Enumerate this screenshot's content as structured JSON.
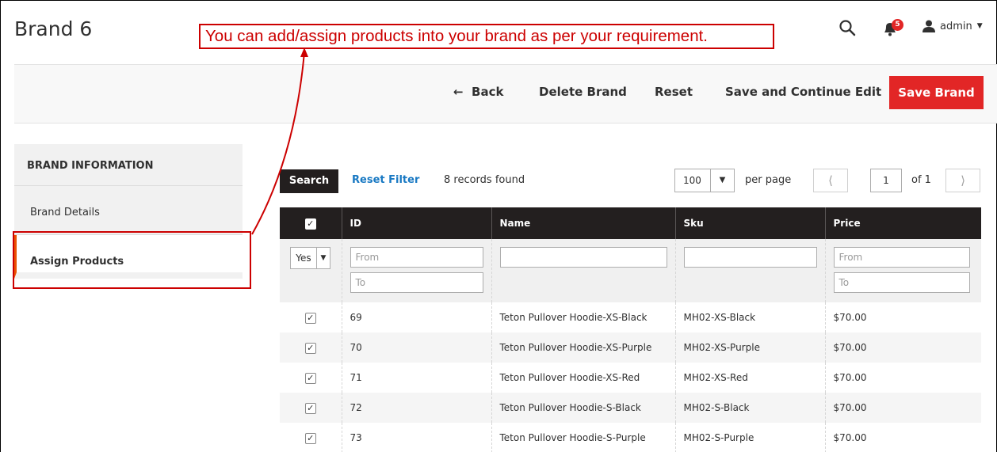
{
  "header": {
    "page_title": "Brand 6",
    "annotation": "You can add/assign products into your brand as per your requirement.",
    "notification_count": "5",
    "user_name": "admin",
    "icons": [
      "search-icon",
      "bell-icon",
      "user-icon",
      "caret-down-icon"
    ]
  },
  "actions": {
    "back": "Back",
    "delete": "Delete Brand",
    "reset": "Reset",
    "save_continue": "Save and Continue Edit",
    "save": "Save Brand"
  },
  "nav": {
    "heading": "BRAND INFORMATION",
    "items": [
      {
        "label": "Brand Details",
        "active": false
      },
      {
        "label": "Assign Products",
        "active": true
      }
    ]
  },
  "grid_controls": {
    "search_label": "Search",
    "reset_filter": "Reset Filter",
    "records_found": "8 records found",
    "per_page_value": "100",
    "per_page_label": "per page",
    "current_page": "1",
    "of_pages": "of 1"
  },
  "table": {
    "columns": [
      "ID",
      "Name",
      "Sku",
      "Price"
    ],
    "filters": {
      "in_brand": "Yes",
      "id_from_placeholder": "From",
      "id_to_placeholder": "To",
      "price_from_placeholder": "From",
      "price_to_placeholder": "To"
    },
    "rows": [
      {
        "id": "69",
        "name": "Teton Pullover Hoodie-XS-Black",
        "sku": "MH02-XS-Black",
        "price": "$70.00",
        "checked": true
      },
      {
        "id": "70",
        "name": "Teton Pullover Hoodie-XS-Purple",
        "sku": "MH02-XS-Purple",
        "price": "$70.00",
        "checked": true
      },
      {
        "id": "71",
        "name": "Teton Pullover Hoodie-XS-Red",
        "sku": "MH02-XS-Red",
        "price": "$70.00",
        "checked": true
      },
      {
        "id": "72",
        "name": "Teton Pullover Hoodie-S-Black",
        "sku": "MH02-S-Black",
        "price": "$70.00",
        "checked": true
      },
      {
        "id": "73",
        "name": "Teton Pullover Hoodie-S-Purple",
        "sku": "MH02-S-Purple",
        "price": "$70.00",
        "checked": true
      }
    ]
  },
  "colors": {
    "accent_red": "#e22626",
    "annotation_red": "#cc0000",
    "table_header": "#231f1f",
    "link_blue": "#1979c3",
    "active_nav_border": "#eb5202"
  }
}
